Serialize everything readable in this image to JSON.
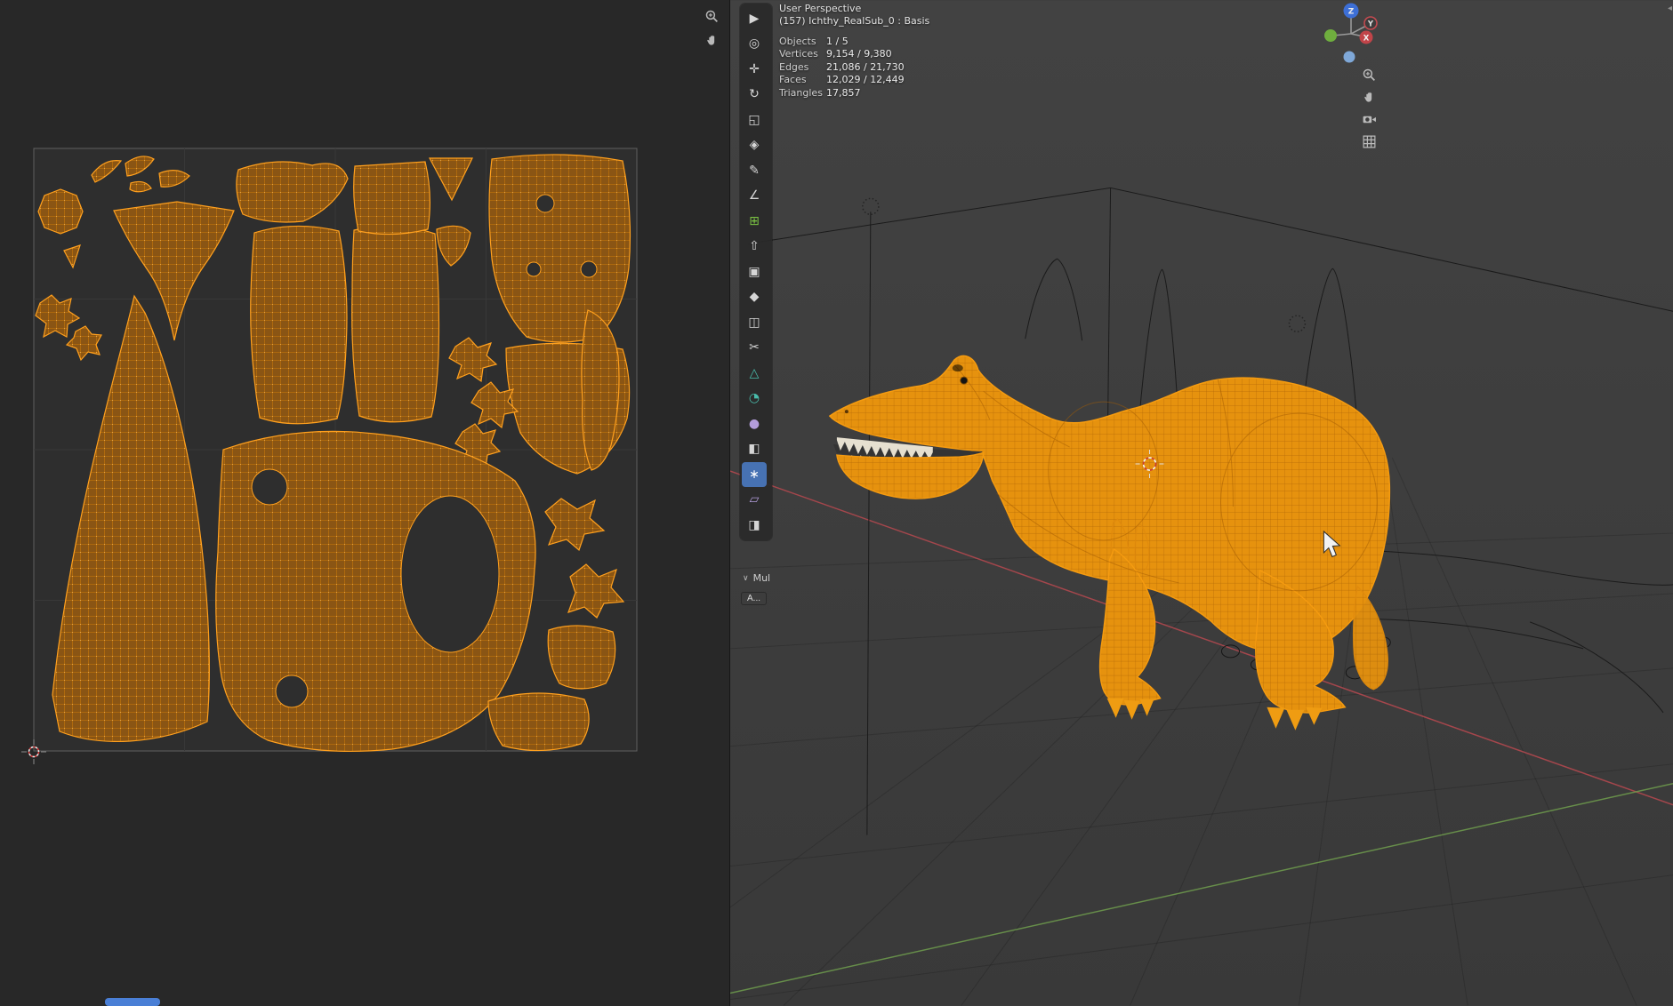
{
  "colors": {
    "uv_island_fill": "#8a5514",
    "uv_island_edge": "#ffa01e",
    "selected_mesh_orange": "#e8930f",
    "active_tool_blue": "#4772b3",
    "axis_x_red": "#b0484e",
    "axis_y_green": "#6f9d4d",
    "gizmo_z_blue": "#3d6fd6",
    "light_yellow": "#d9e04e",
    "progress_blue": "#4a7fd6",
    "viewport_bg": "#3c3c3c",
    "uv_bg": "#282828"
  },
  "uv_editor": {
    "zoom_icon": "zoom-in-icon",
    "pan_icon": "pan-hand-icon"
  },
  "viewport": {
    "header": {
      "view_label": "User Perspective",
      "object_label": "(157) Ichthy_RealSub_0 : Basis"
    },
    "stats": {
      "rows": [
        {
          "label": "Objects",
          "value": "1 / 5"
        },
        {
          "label": "Vertices",
          "value": "9,154 / 9,380"
        },
        {
          "label": "Edges",
          "value": "21,086 / 21,730"
        },
        {
          "label": "Faces",
          "value": "12,029 / 12,449"
        },
        {
          "label": "Triangles",
          "value": "17,857"
        }
      ]
    },
    "gizmo": {
      "z": "Z",
      "y": "Y",
      "x": "X"
    },
    "nav_icons": [
      "zoom-in-icon",
      "pan-hand-icon",
      "camera-view-icon",
      "toggle-ortho-grid-icon"
    ],
    "collapse_arrow": "◂"
  },
  "toolbar": {
    "items": [
      {
        "name": "select-box",
        "glyph": "▶"
      },
      {
        "name": "cursor",
        "glyph": "◎"
      },
      {
        "name": "move",
        "glyph": "✛"
      },
      {
        "name": "rotate",
        "glyph": "↻"
      },
      {
        "name": "scale",
        "glyph": "◱"
      },
      {
        "name": "transform",
        "glyph": "◈"
      },
      {
        "name": "annotate",
        "glyph": "✎"
      },
      {
        "name": "measure",
        "glyph": "∠"
      },
      {
        "name": "add-cube",
        "glyph": "⊞"
      },
      {
        "name": "extrude-region",
        "glyph": "⇧"
      },
      {
        "name": "inset-faces",
        "glyph": "▣"
      },
      {
        "name": "bevel",
        "glyph": "◆"
      },
      {
        "name": "loop-cut",
        "glyph": "◫"
      },
      {
        "name": "knife",
        "glyph": "✂"
      },
      {
        "name": "poly-build",
        "glyph": "△"
      },
      {
        "name": "spin",
        "glyph": "◔"
      },
      {
        "name": "smooth",
        "glyph": "●"
      },
      {
        "name": "edge-slide",
        "glyph": "◧"
      },
      {
        "name": "shrink-fatten",
        "glyph": "∗",
        "active": true
      },
      {
        "name": "shear",
        "glyph": "▱"
      },
      {
        "name": "rip-region",
        "glyph": "◨"
      }
    ]
  },
  "panels": {
    "chevron": "∨",
    "mul_label": "Mul",
    "a_button": "A..."
  }
}
